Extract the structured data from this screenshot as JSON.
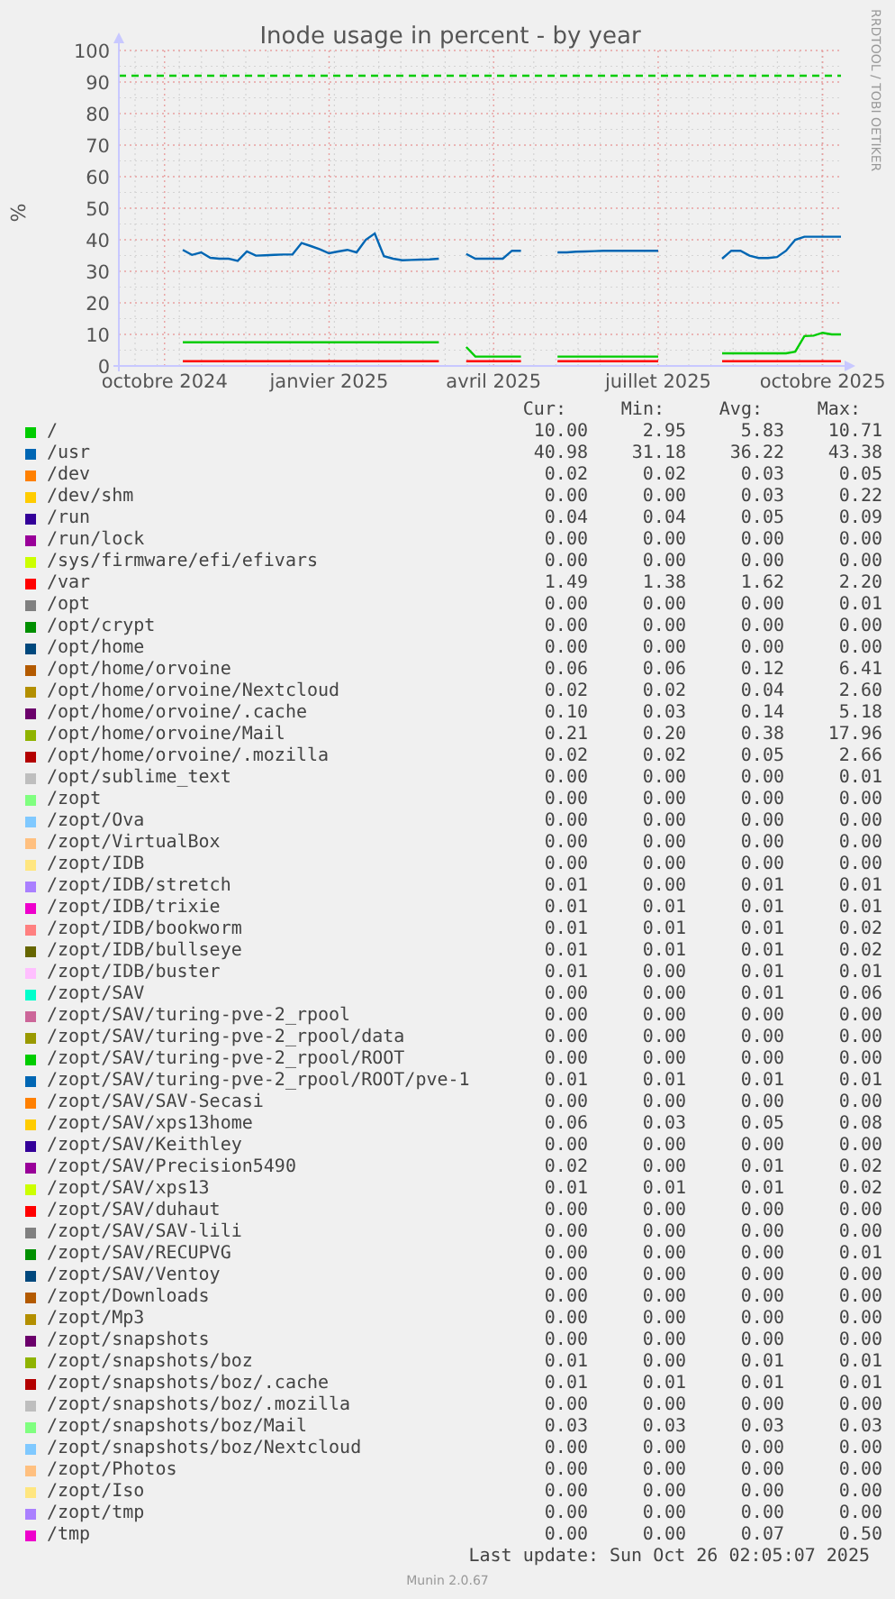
{
  "graph": {
    "credit": "RRDTOOL / TOBI OETIKER",
    "chart_data": {
      "type": "line",
      "title": "Inode usage in percent - by year",
      "ylabel": "%",
      "ylim": [
        0,
        100
      ],
      "yticks": [
        0,
        10,
        20,
        30,
        40,
        50,
        60,
        70,
        80,
        90,
        100
      ],
      "categories": [
        null,
        null,
        null,
        null,
        null,
        "octobre 2024",
        null,
        null,
        null,
        null,
        null,
        null,
        null,
        null,
        null,
        null,
        null,
        null,
        null,
        null,
        null,
        null,
        null,
        "janvier 2025",
        null,
        null,
        null,
        null,
        null,
        null,
        null,
        null,
        null,
        null,
        null,
        null,
        null,
        null,
        null,
        null,
        null,
        "avril 2025",
        null,
        null,
        null,
        null,
        null,
        null,
        null,
        null,
        null,
        null,
        null,
        null,
        null,
        null,
        null,
        null,
        null,
        "juillet 2025",
        null,
        null,
        null,
        null,
        null,
        null,
        null,
        null,
        null,
        null,
        null,
        null,
        null,
        null,
        null,
        null,
        null,
        "octobre 2025",
        null,
        null
      ],
      "series": [
        {
          "color": "#00cc00",
          "line_style": "dashed",
          "values": [
            92,
            92,
            92,
            92,
            92,
            92,
            92,
            92,
            92,
            92,
            92,
            92,
            92,
            92,
            92,
            92,
            92,
            92,
            92,
            92,
            92,
            92,
            92,
            92,
            92,
            92,
            92,
            92,
            92,
            92,
            92,
            92,
            92,
            92,
            92,
            92,
            92,
            92,
            92,
            92,
            92,
            92,
            92,
            92,
            92,
            92,
            92,
            92,
            92,
            92,
            92,
            92,
            92,
            92,
            92,
            92,
            92,
            92,
            92,
            92,
            92,
            92,
            92,
            92,
            92,
            92,
            92,
            92,
            92,
            92,
            92,
            92,
            92,
            92,
            92,
            92,
            92,
            92,
            92,
            92
          ]
        },
        {
          "color": "#00cc00",
          "values": [
            null,
            null,
            null,
            null,
            null,
            null,
            null,
            7.5,
            7.5,
            7.5,
            7.5,
            7.5,
            7.5,
            7.5,
            7.5,
            7.5,
            7.5,
            7.5,
            7.5,
            7.5,
            7.5,
            7.5,
            7.5,
            7.5,
            7.5,
            7.5,
            7.5,
            7.5,
            7.5,
            7.5,
            7.5,
            7.5,
            7.5,
            7.5,
            7.5,
            7.5,
            null,
            null,
            6,
            3,
            3,
            3,
            3,
            3,
            3,
            null,
            null,
            null,
            3,
            3,
            3,
            3,
            3,
            3,
            3,
            3,
            3,
            3,
            3,
            3,
            null,
            null,
            null,
            null,
            null,
            null,
            4,
            4,
            4,
            4,
            4,
            4,
            4,
            4,
            4.5,
            9.5,
            9.6,
            10.5,
            10,
            10
          ]
        },
        {
          "color": "#0066b3",
          "values": [
            null,
            null,
            null,
            null,
            null,
            null,
            null,
            36.8,
            35.2,
            36,
            34.3,
            34,
            34,
            33.3,
            36.3,
            35,
            35.1,
            35.2,
            35.3,
            35.4,
            39,
            38,
            37,
            35.7,
            36.3,
            36.8,
            36,
            40,
            42,
            34.8,
            34,
            33.5,
            33.6,
            33.7,
            33.8,
            34,
            null,
            null,
            35.5,
            34,
            34,
            34,
            34,
            36.5,
            36.5,
            null,
            null,
            null,
            36,
            36,
            36.2,
            36.3,
            36.4,
            36.5,
            36.5,
            36.5,
            36.5,
            36.5,
            36.5,
            36.5,
            null,
            null,
            null,
            null,
            null,
            null,
            34,
            36.5,
            36.5,
            35,
            34.2,
            34.2,
            34.5,
            36.5,
            40,
            41,
            41,
            41,
            41,
            41
          ]
        },
        {
          "color": "#ff0000",
          "values": [
            null,
            null,
            null,
            null,
            null,
            null,
            null,
            1.5,
            1.5,
            1.5,
            1.5,
            1.5,
            1.5,
            1.5,
            1.5,
            1.5,
            1.5,
            1.5,
            1.5,
            1.5,
            1.5,
            1.5,
            1.5,
            1.5,
            1.5,
            1.5,
            1.5,
            1.5,
            1.5,
            1.5,
            1.5,
            1.5,
            1.5,
            1.5,
            1.5,
            1.5,
            null,
            null,
            1.5,
            1.5,
            1.5,
            1.5,
            1.5,
            1.5,
            1.5,
            null,
            null,
            null,
            1.5,
            1.5,
            1.5,
            1.5,
            1.5,
            1.5,
            1.5,
            1.5,
            1.5,
            1.5,
            1.5,
            1.5,
            null,
            null,
            null,
            null,
            null,
            null,
            1.5,
            1.5,
            1.5,
            1.5,
            1.5,
            1.5,
            1.5,
            1.5,
            1.5,
            1.5,
            1.5,
            1.5,
            1.5,
            1.5
          ]
        }
      ],
      "grid": true
    }
  },
  "legend": {
    "columns": [
      "Cur:",
      "Min:",
      "Avg:",
      "Max:"
    ],
    "items": [
      {
        "name": "/",
        "color": "#00cc00",
        "cur": "10.00",
        "min": "2.95",
        "avg": "5.83",
        "max": "10.71"
      },
      {
        "name": "/usr",
        "color": "#0066b3",
        "cur": "40.98",
        "min": "31.18",
        "avg": "36.22",
        "max": "43.38"
      },
      {
        "name": "/dev",
        "color": "#ff8000",
        "cur": "0.02",
        "min": "0.02",
        "avg": "0.03",
        "max": "0.05"
      },
      {
        "name": "/dev/shm",
        "color": "#ffcc00",
        "cur": "0.00",
        "min": "0.00",
        "avg": "0.03",
        "max": "0.22"
      },
      {
        "name": "/run",
        "color": "#330099",
        "cur": "0.04",
        "min": "0.04",
        "avg": "0.05",
        "max": "0.09"
      },
      {
        "name": "/run/lock",
        "color": "#990099",
        "cur": "0.00",
        "min": "0.00",
        "avg": "0.00",
        "max": "0.00"
      },
      {
        "name": "/sys/firmware/efi/efivars",
        "color": "#ccff00",
        "cur": "0.00",
        "min": "0.00",
        "avg": "0.00",
        "max": "0.00"
      },
      {
        "name": "/var",
        "color": "#ff0000",
        "cur": "1.49",
        "min": "1.38",
        "avg": "1.62",
        "max": "2.20"
      },
      {
        "name": "/opt",
        "color": "#808080",
        "cur": "0.00",
        "min": "0.00",
        "avg": "0.00",
        "max": "0.01"
      },
      {
        "name": "/opt/crypt",
        "color": "#008f00",
        "cur": "0.00",
        "min": "0.00",
        "avg": "0.00",
        "max": "0.00"
      },
      {
        "name": "/opt/home",
        "color": "#00487d",
        "cur": "0.00",
        "min": "0.00",
        "avg": "0.00",
        "max": "0.00"
      },
      {
        "name": "/opt/home/orvoine",
        "color": "#b35a00",
        "cur": "0.06",
        "min": "0.06",
        "avg": "0.12",
        "max": "6.41"
      },
      {
        "name": "/opt/home/orvoine/Nextcloud",
        "color": "#b38f00",
        "cur": "0.02",
        "min": "0.02",
        "avg": "0.04",
        "max": "2.60"
      },
      {
        "name": "/opt/home/orvoine/.cache",
        "color": "#6b006b",
        "cur": "0.10",
        "min": "0.03",
        "avg": "0.14",
        "max": "5.18"
      },
      {
        "name": "/opt/home/orvoine/Mail",
        "color": "#8fb300",
        "cur": "0.21",
        "min": "0.20",
        "avg": "0.38",
        "max": "17.96"
      },
      {
        "name": "/opt/home/orvoine/.mozilla",
        "color": "#b30000",
        "cur": "0.02",
        "min": "0.02",
        "avg": "0.05",
        "max": "2.66"
      },
      {
        "name": "/opt/sublime_text",
        "color": "#bebebe",
        "cur": "0.00",
        "min": "0.00",
        "avg": "0.00",
        "max": "0.01"
      },
      {
        "name": "/zopt",
        "color": "#80ff80",
        "cur": "0.00",
        "min": "0.00",
        "avg": "0.00",
        "max": "0.00"
      },
      {
        "name": "/zopt/Ova",
        "color": "#80c9ff",
        "cur": "0.00",
        "min": "0.00",
        "avg": "0.00",
        "max": "0.00"
      },
      {
        "name": "/zopt/VirtualBox",
        "color": "#ffc080",
        "cur": "0.00",
        "min": "0.00",
        "avg": "0.00",
        "max": "0.00"
      },
      {
        "name": "/zopt/IDB",
        "color": "#ffe680",
        "cur": "0.00",
        "min": "0.00",
        "avg": "0.00",
        "max": "0.00"
      },
      {
        "name": "/zopt/IDB/stretch",
        "color": "#aa80ff",
        "cur": "0.01",
        "min": "0.00",
        "avg": "0.01",
        "max": "0.01"
      },
      {
        "name": "/zopt/IDB/trixie",
        "color": "#ee00cc",
        "cur": "0.01",
        "min": "0.01",
        "avg": "0.01",
        "max": "0.01"
      },
      {
        "name": "/zopt/IDB/bookworm",
        "color": "#ff8080",
        "cur": "0.01",
        "min": "0.01",
        "avg": "0.01",
        "max": "0.02"
      },
      {
        "name": "/zopt/IDB/bullseye",
        "color": "#666600",
        "cur": "0.01",
        "min": "0.01",
        "avg": "0.01",
        "max": "0.02"
      },
      {
        "name": "/zopt/IDB/buster",
        "color": "#ffbfff",
        "cur": "0.01",
        "min": "0.00",
        "avg": "0.01",
        "max": "0.01"
      },
      {
        "name": "/zopt/SAV",
        "color": "#00ffcc",
        "cur": "0.00",
        "min": "0.00",
        "avg": "0.01",
        "max": "0.06"
      },
      {
        "name": "/zopt/SAV/turing-pve-2_rpool",
        "color": "#cc6699",
        "cur": "0.00",
        "min": "0.00",
        "avg": "0.00",
        "max": "0.00"
      },
      {
        "name": "/zopt/SAV/turing-pve-2_rpool/data",
        "color": "#999900",
        "cur": "0.00",
        "min": "0.00",
        "avg": "0.00",
        "max": "0.00"
      },
      {
        "name": "/zopt/SAV/turing-pve-2_rpool/ROOT",
        "color": "#00cc00",
        "cur": "0.00",
        "min": "0.00",
        "avg": "0.00",
        "max": "0.00"
      },
      {
        "name": "/zopt/SAV/turing-pve-2_rpool/ROOT/pve-1",
        "color": "#0066b3",
        "cur": "0.01",
        "min": "0.01",
        "avg": "0.01",
        "max": "0.01"
      },
      {
        "name": "/zopt/SAV/SAV-Secasi",
        "color": "#ff8000",
        "cur": "0.00",
        "min": "0.00",
        "avg": "0.00",
        "max": "0.00"
      },
      {
        "name": "/zopt/SAV/xps13home",
        "color": "#ffcc00",
        "cur": "0.06",
        "min": "0.03",
        "avg": "0.05",
        "max": "0.08"
      },
      {
        "name": "/zopt/SAV/Keithley",
        "color": "#330099",
        "cur": "0.00",
        "min": "0.00",
        "avg": "0.00",
        "max": "0.00"
      },
      {
        "name": "/zopt/SAV/Precision5490",
        "color": "#990099",
        "cur": "0.02",
        "min": "0.00",
        "avg": "0.01",
        "max": "0.02"
      },
      {
        "name": "/zopt/SAV/xps13",
        "color": "#ccff00",
        "cur": "0.01",
        "min": "0.01",
        "avg": "0.01",
        "max": "0.02"
      },
      {
        "name": "/zopt/SAV/duhaut",
        "color": "#ff0000",
        "cur": "0.00",
        "min": "0.00",
        "avg": "0.00",
        "max": "0.00"
      },
      {
        "name": "/zopt/SAV/SAV-lili",
        "color": "#808080",
        "cur": "0.00",
        "min": "0.00",
        "avg": "0.00",
        "max": "0.00"
      },
      {
        "name": "/zopt/SAV/RECUPVG",
        "color": "#008f00",
        "cur": "0.00",
        "min": "0.00",
        "avg": "0.00",
        "max": "0.01"
      },
      {
        "name": "/zopt/SAV/Ventoy",
        "color": "#00487d",
        "cur": "0.00",
        "min": "0.00",
        "avg": "0.00",
        "max": "0.00"
      },
      {
        "name": "/zopt/Downloads",
        "color": "#b35a00",
        "cur": "0.00",
        "min": "0.00",
        "avg": "0.00",
        "max": "0.00"
      },
      {
        "name": "/zopt/Mp3",
        "color": "#b38f00",
        "cur": "0.00",
        "min": "0.00",
        "avg": "0.00",
        "max": "0.00"
      },
      {
        "name": "/zopt/snapshots",
        "color": "#6b006b",
        "cur": "0.00",
        "min": "0.00",
        "avg": "0.00",
        "max": "0.00"
      },
      {
        "name": "/zopt/snapshots/boz",
        "color": "#8fb300",
        "cur": "0.01",
        "min": "0.00",
        "avg": "0.01",
        "max": "0.01"
      },
      {
        "name": "/zopt/snapshots/boz/.cache",
        "color": "#b30000",
        "cur": "0.01",
        "min": "0.01",
        "avg": "0.01",
        "max": "0.01"
      },
      {
        "name": "/zopt/snapshots/boz/.mozilla",
        "color": "#bebebe",
        "cur": "0.00",
        "min": "0.00",
        "avg": "0.00",
        "max": "0.00"
      },
      {
        "name": "/zopt/snapshots/boz/Mail",
        "color": "#80ff80",
        "cur": "0.03",
        "min": "0.03",
        "avg": "0.03",
        "max": "0.03"
      },
      {
        "name": "/zopt/snapshots/boz/Nextcloud",
        "color": "#80c9ff",
        "cur": "0.00",
        "min": "0.00",
        "avg": "0.00",
        "max": "0.00"
      },
      {
        "name": "/zopt/Photos",
        "color": "#ffc080",
        "cur": "0.00",
        "min": "0.00",
        "avg": "0.00",
        "max": "0.00"
      },
      {
        "name": "/zopt/Iso",
        "color": "#ffe680",
        "cur": "0.00",
        "min": "0.00",
        "avg": "0.00",
        "max": "0.00"
      },
      {
        "name": "/zopt/tmp",
        "color": "#aa80ff",
        "cur": "0.00",
        "min": "0.00",
        "avg": "0.00",
        "max": "0.00"
      },
      {
        "name": "/tmp",
        "color": "#ee00cc",
        "cur": "0.00",
        "min": "0.00",
        "avg": "0.07",
        "max": "0.50"
      }
    ]
  },
  "last_update": "Last update: Sun Oct 26 02:05:07 2025",
  "footer": "Munin 2.0.67"
}
